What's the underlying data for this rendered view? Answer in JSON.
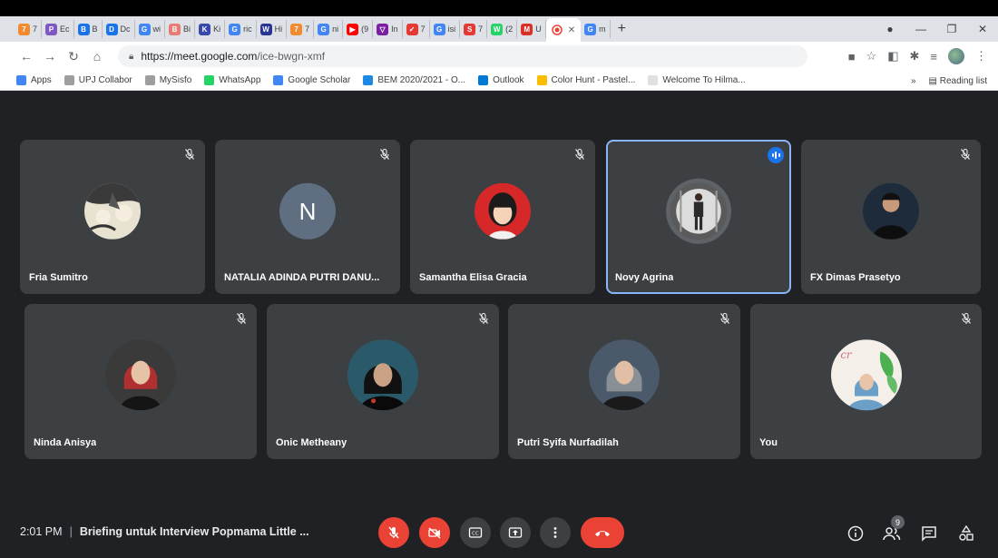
{
  "browser": {
    "tabs": [
      {
        "icon_text": "7",
        "label": "7",
        "color": "#f28b30"
      },
      {
        "icon_text": "P",
        "label": "Ec",
        "color": "#7e57c2"
      },
      {
        "icon_text": "B",
        "label": "B",
        "color": "#1a73e8"
      },
      {
        "icon_text": "D",
        "label": "Dc",
        "color": "#1a73e8"
      },
      {
        "icon_text": "G",
        "label": "wi",
        "color": "#4285f4"
      },
      {
        "icon_text": "B",
        "label": "Bi",
        "color": "#e67c73"
      },
      {
        "icon_text": "K",
        "label": "Ki",
        "color": "#3949ab"
      },
      {
        "icon_text": "G",
        "label": "ric",
        "color": "#4285f4"
      },
      {
        "icon_text": "W",
        "label": "Hi",
        "color": "#283593"
      },
      {
        "icon_text": "7",
        "label": "7",
        "color": "#f28b30"
      },
      {
        "icon_text": "G",
        "label": "ni",
        "color": "#4285f4"
      },
      {
        "icon_text": "▶",
        "label": "(9",
        "color": "#ff0000"
      },
      {
        "icon_text": "▽",
        "label": "In",
        "color": "#7b1fa2"
      },
      {
        "icon_text": "✓",
        "label": "7",
        "color": "#e53935"
      },
      {
        "icon_text": "G",
        "label": "isi",
        "color": "#4285f4"
      },
      {
        "icon_text": "S",
        "label": "7",
        "color": "#e53935"
      },
      {
        "icon_text": "W",
        "label": "(2",
        "color": "#25d366"
      },
      {
        "icon_text": "M",
        "label": "U",
        "color": "#d93025"
      }
    ],
    "active_tab_label": "",
    "last_tab": {
      "icon_text": "G",
      "label": "m"
    },
    "new_tab": "+",
    "url_host": "https://meet.google.com",
    "url_path": "/ice-bwgn-xmf",
    "bookmarks": [
      {
        "label": "Apps",
        "color": "#4285f4"
      },
      {
        "label": "UPJ Collabor",
        "color": "#9e9e9e"
      },
      {
        "label": "MySisfo",
        "color": "#9e9e9e"
      },
      {
        "label": "WhatsApp",
        "color": "#25d366"
      },
      {
        "label": "Google Scholar",
        "color": "#4285f4"
      },
      {
        "label": "BEM 2020/2021 - O...",
        "color": "#1e88e5"
      },
      {
        "label": "Outlook",
        "color": "#0078d4"
      },
      {
        "label": "Color Hunt - Pastel...",
        "color": "#fbbc04"
      },
      {
        "label": "Welcome To Hilma...",
        "color": "#e0e0e0"
      }
    ],
    "more_bookmarks": "»",
    "reading_list": "Reading list"
  },
  "meet": {
    "participants": [
      {
        "name": "Fria Sumitro",
        "avatar": "anime"
      },
      {
        "name": "NATALIA ADINDA PUTRI DANU...",
        "avatar": "letter",
        "letter": "N"
      },
      {
        "name": "Samantha Elisa Gracia",
        "avatar": "girl-red"
      },
      {
        "name": "Novy Agrina",
        "avatar": "standing",
        "speaking": true
      },
      {
        "name": "FX Dimas Prasetyo",
        "avatar": "man-dark"
      },
      {
        "name": "Ninda Anisya",
        "avatar": "hijab-red"
      },
      {
        "name": "Onic Metheany",
        "avatar": "hijab-black"
      },
      {
        "name": "Putri Syifa Nurfadilah",
        "avatar": "hijab-grey"
      },
      {
        "name": "You",
        "avatar": "floral"
      }
    ],
    "time": "2:01 PM",
    "separator": "|",
    "meeting_title": "Briefing untuk Interview Popmama Little ...",
    "people_count": "9",
    "accent": "#1a73e8",
    "danger": "#ea4335"
  }
}
